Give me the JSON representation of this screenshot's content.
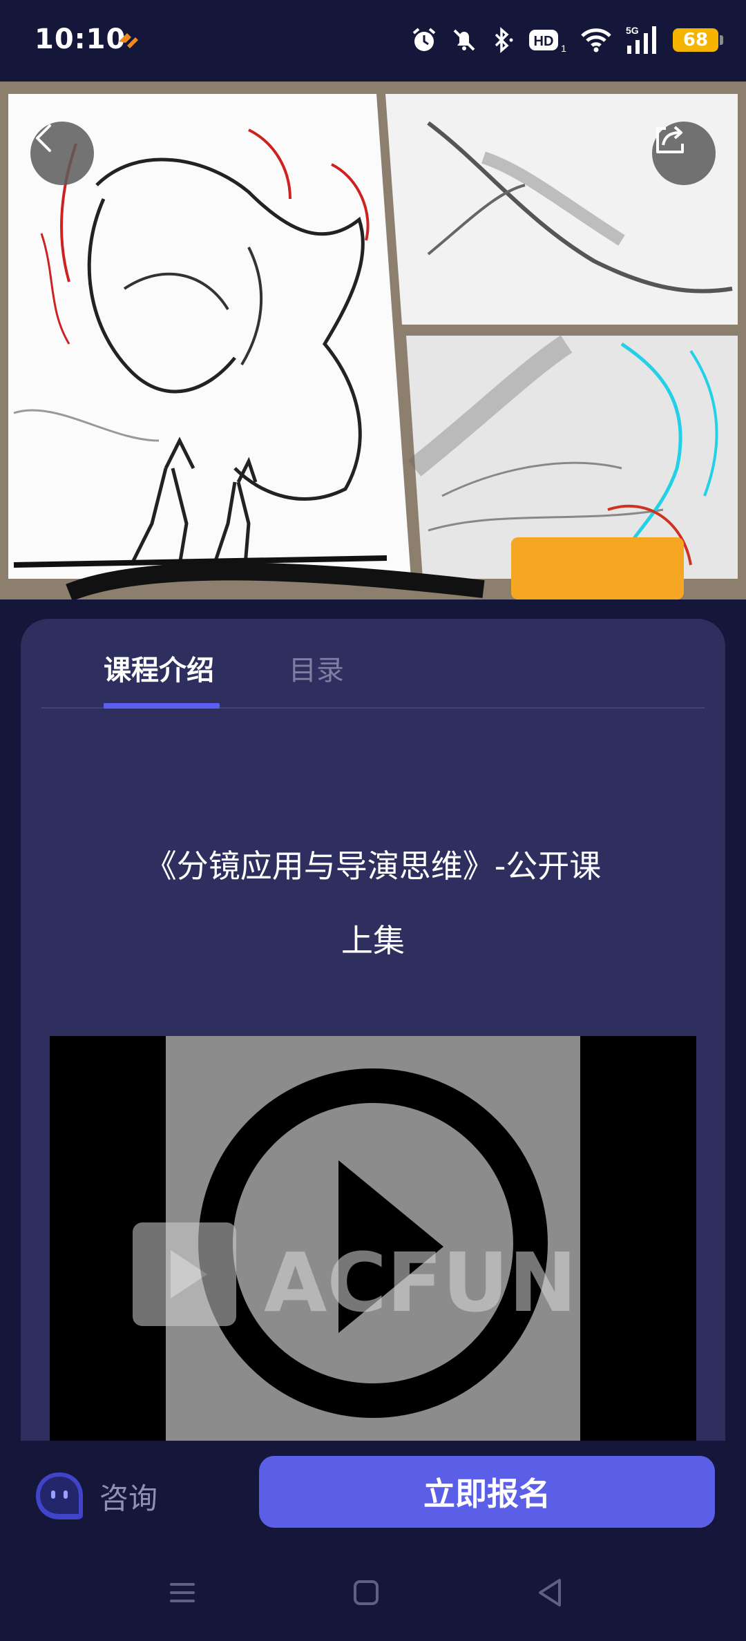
{
  "status_bar": {
    "time": "10:10",
    "battery": "68",
    "network": "5G",
    "hd_label": "HD",
    "hd_sub": "1",
    "icons": [
      "orange-app-icon",
      "alarm-icon",
      "silent-bell-icon",
      "bluetooth-icon",
      "hd-voice-icon",
      "wifi-icon",
      "signal-icon",
      "battery-icon"
    ],
    "battery_color": "#f5b400"
  },
  "banner": {
    "icons": [
      "back-icon",
      "share-icon"
    ]
  },
  "tabs": [
    {
      "label": "课程介绍",
      "active": true
    },
    {
      "label": "目录",
      "active": false
    }
  ],
  "course": {
    "title": "《分镜应用与导演思维》-公开课",
    "subtitle": "上集"
  },
  "video": {
    "watermark": "ACFUN",
    "icons": [
      "play-icon"
    ]
  },
  "action_bar": {
    "consult_label": "咨询",
    "enroll_label": "立即报名",
    "accent_color": "#5b5fe8"
  },
  "nav_bar": {
    "icons": [
      "menu-icon",
      "home-icon",
      "back-triangle-icon"
    ]
  }
}
